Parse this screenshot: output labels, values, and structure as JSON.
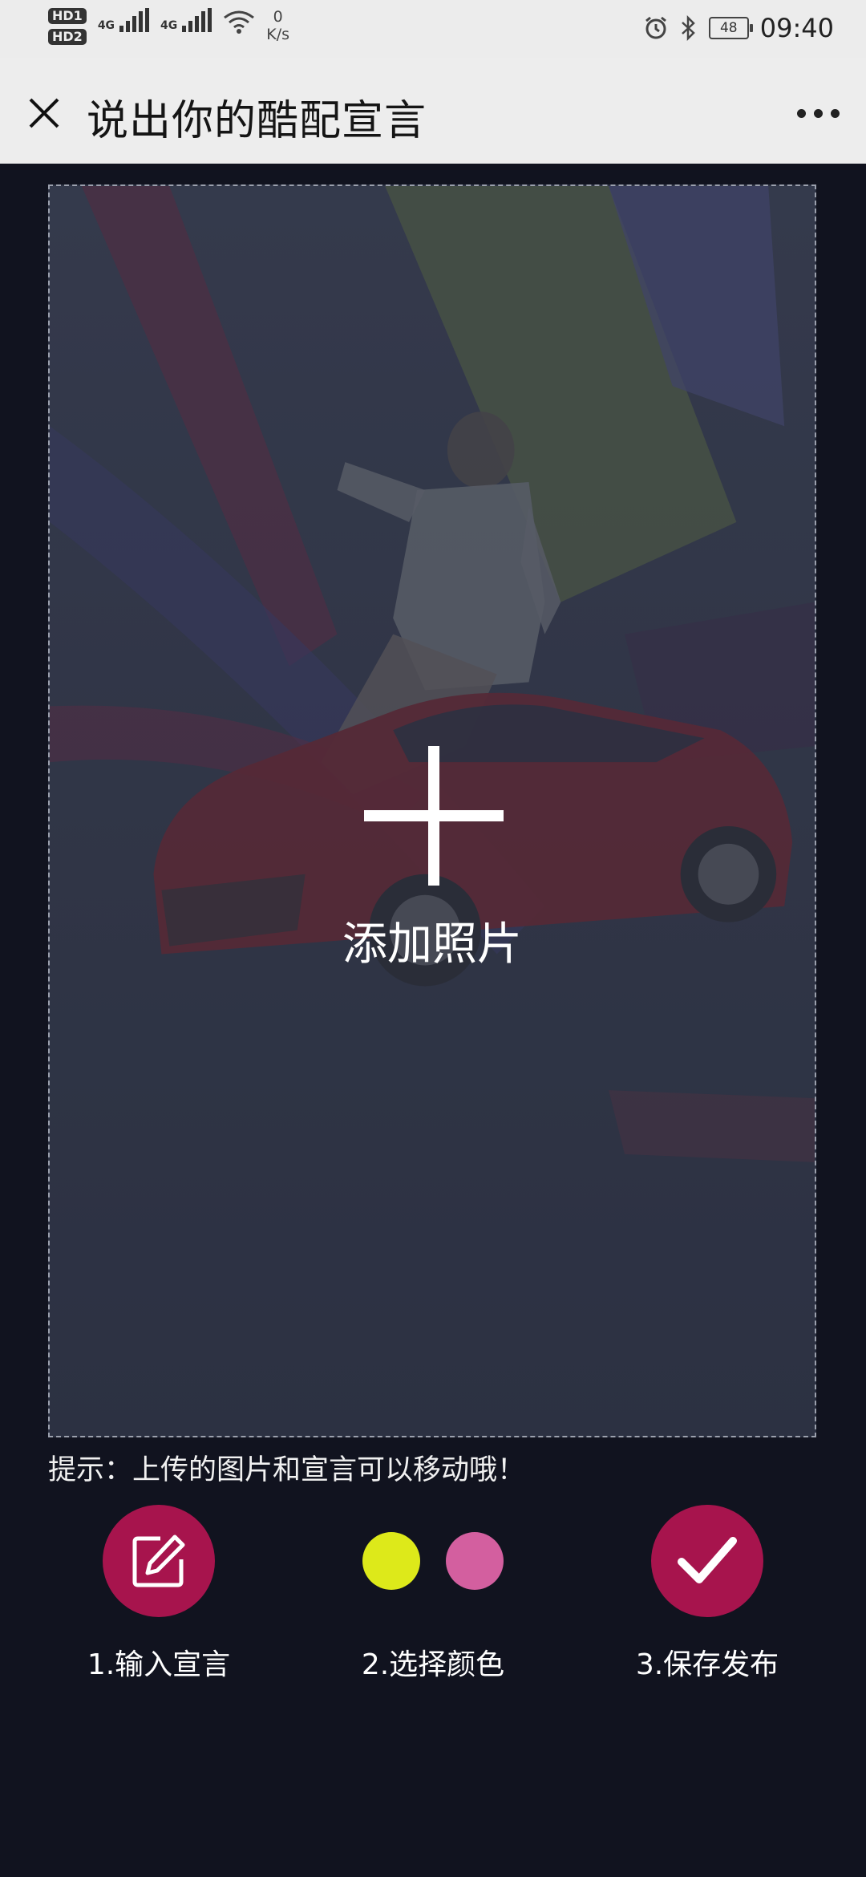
{
  "status_bar": {
    "sim1_badge": "HD1",
    "sim2_badge": "HD2",
    "net1": "4G",
    "net2": "4G",
    "speed_value": "0",
    "speed_unit": "K/s",
    "battery": "48",
    "time": "09:40",
    "icons": [
      "alarm-icon",
      "bluetooth-icon",
      "wifi-icon",
      "signal-icon",
      "battery-icon"
    ]
  },
  "header": {
    "title": "说出你的酷配宣言",
    "close_icon": "close-icon",
    "more_icon": "more-icon"
  },
  "canvas": {
    "add_label": "添加照片",
    "add_icon": "plus-icon"
  },
  "tip": "提示：上传的图片和宣言可以移动哦！",
  "steps": [
    {
      "label": "1.输入宣言",
      "icon": "edit-icon"
    },
    {
      "label": "2.选择颜色",
      "icon": "color-swatches"
    },
    {
      "label": "3.保存发布",
      "icon": "check-icon"
    }
  ],
  "colors": {
    "accent": "#a7144d",
    "swatch_yellow": "#dde91a",
    "swatch_pink": "#d35f9f",
    "background": "#11131f"
  }
}
